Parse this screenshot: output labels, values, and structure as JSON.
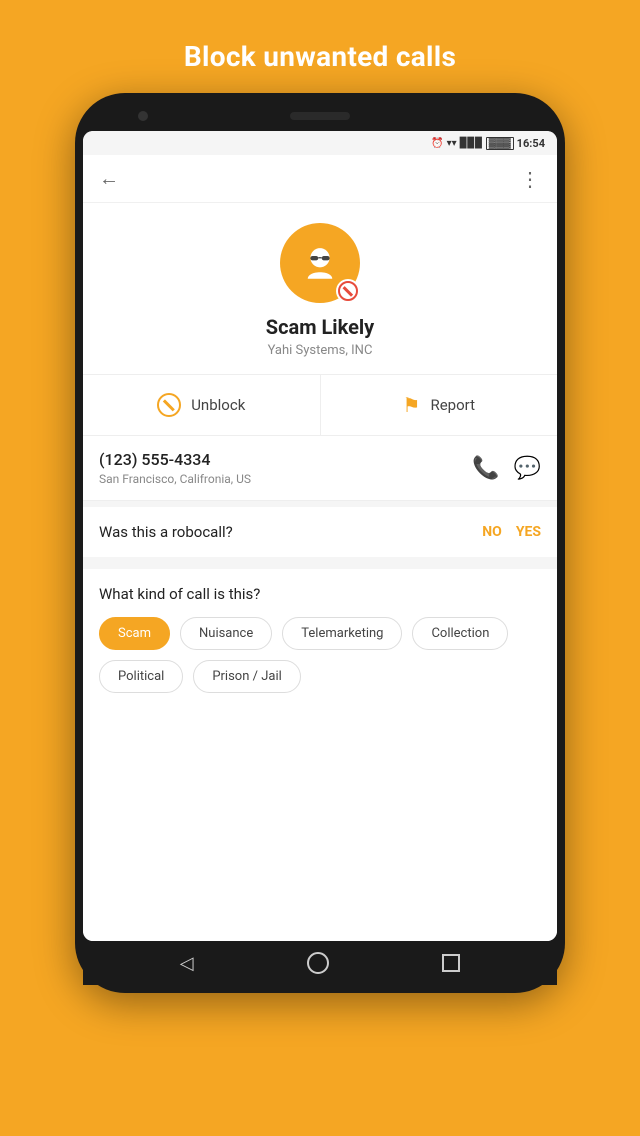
{
  "page": {
    "header": "Block unwanted calls",
    "status_bar": {
      "time": "16:54",
      "icons": [
        "alarm",
        "wifi",
        "signal",
        "battery"
      ]
    },
    "contact": {
      "name": "Scam Likely",
      "company": "Yahi Systems, INC"
    },
    "actions": {
      "unblock_label": "Unblock",
      "report_label": "Report"
    },
    "phone_info": {
      "number": "(123) 555-4334",
      "location": "San Francisco, Califronia, US"
    },
    "robocall": {
      "question": "Was this a robocall?",
      "no_label": "NO",
      "yes_label": "YES"
    },
    "call_type": {
      "title": "What kind of call is this?",
      "options": [
        {
          "label": "Scam",
          "active": true
        },
        {
          "label": "Nuisance",
          "active": false
        },
        {
          "label": "Telemarketing",
          "active": false
        },
        {
          "label": "Collection",
          "active": false
        },
        {
          "label": "Political",
          "active": false
        },
        {
          "label": "Prison / Jail",
          "active": false
        }
      ]
    },
    "nav": {
      "back": "◁",
      "home": "○",
      "recent": "□"
    }
  }
}
